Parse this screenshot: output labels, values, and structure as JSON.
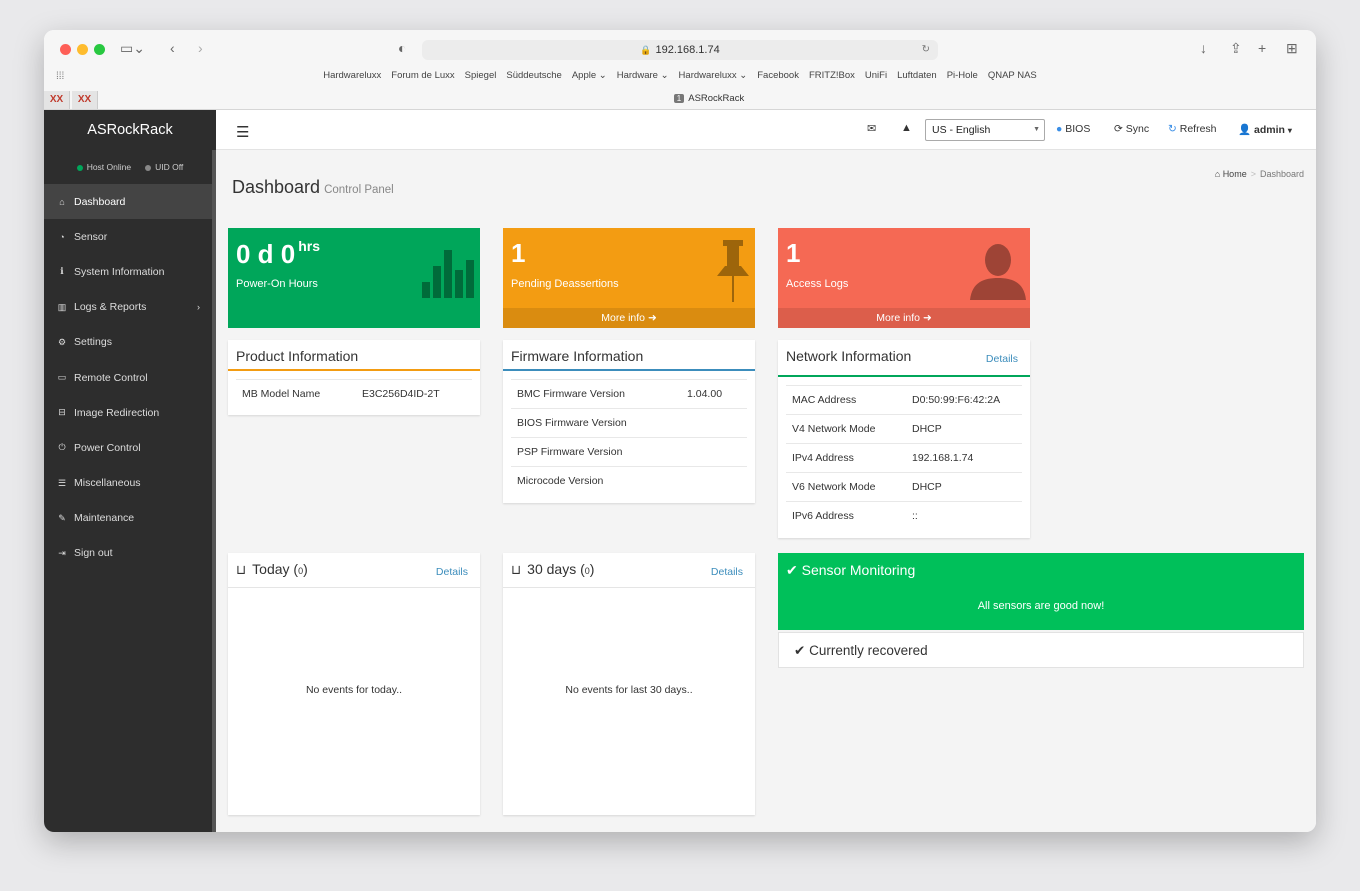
{
  "browser": {
    "url": "192.168.1.74",
    "tab_title": "ASRockRack",
    "tab_number": "1",
    "favicons": [
      "XX",
      "XX"
    ],
    "bookmarks": [
      "Hardwareluxx",
      "Forum de Luxx",
      "Spiegel",
      "Süddeutsche",
      "Apple ⌄",
      "Hardware ⌄",
      "Hardwareluxx ⌄",
      "Facebook",
      "FRITZ!Box",
      "UniFi",
      "Luftdaten",
      "Pi-Hole",
      "QNAP NAS"
    ]
  },
  "sidebar": {
    "brand": "ASRockRack",
    "host_status": "Host Online",
    "uid_status": "UID Off",
    "items": [
      {
        "label": "Dashboard",
        "icon": "home-icon"
      },
      {
        "label": "Sensor",
        "icon": "gauge-icon"
      },
      {
        "label": "System Information",
        "icon": "info-icon"
      },
      {
        "label": "Logs & Reports",
        "icon": "bar-chart-icon"
      },
      {
        "label": "Settings",
        "icon": "gear-icon"
      },
      {
        "label": "Remote Control",
        "icon": "monitor-icon"
      },
      {
        "label": "Image Redirection",
        "icon": "drive-icon"
      },
      {
        "label": "Power Control",
        "icon": "power-icon"
      },
      {
        "label": "Miscellaneous",
        "icon": "list-icon"
      },
      {
        "label": "Maintenance",
        "icon": "wrench-icon"
      },
      {
        "label": "Sign out",
        "icon": "sign-out-icon"
      }
    ]
  },
  "topbar": {
    "language": "US - English",
    "bios": "BIOS",
    "sync": "Sync",
    "refresh": "Refresh",
    "user": "admin"
  },
  "page": {
    "title": "Dashboard",
    "subtitle": "Control Panel",
    "breadcrumb_home": "Home",
    "breadcrumb_current": "Dashboard"
  },
  "tiles": {
    "power": {
      "value": "0 d 0",
      "unit": "hrs",
      "label": "Power-On Hours",
      "color": "#00a65a"
    },
    "pending": {
      "value": "1",
      "label": "Pending Deassertions",
      "more": "More info",
      "color": "#f39c12"
    },
    "access": {
      "value": "1",
      "label": "Access Logs",
      "more": "More info",
      "color": "#f56954"
    }
  },
  "product": {
    "title": "Product Information",
    "rows": [
      {
        "key": "MB Model Name",
        "value": "E3C256D4ID-2T"
      }
    ]
  },
  "firmware": {
    "title": "Firmware Information",
    "rows": [
      {
        "key": "BMC Firmware Version",
        "value": "1.04.00"
      },
      {
        "key": "BIOS Firmware Version",
        "value": ""
      },
      {
        "key": "PSP Firmware Version",
        "value": ""
      },
      {
        "key": "Microcode Version",
        "value": ""
      }
    ]
  },
  "network": {
    "title": "Network Information",
    "details": "Details",
    "rows": [
      {
        "key": "MAC Address",
        "value": "D0:50:99:F6:42:2A"
      },
      {
        "key": "V4 Network Mode",
        "value": "DHCP"
      },
      {
        "key": "IPv4 Address",
        "value": "192.168.1.74"
      },
      {
        "key": "V6 Network Mode",
        "value": "DHCP"
      },
      {
        "key": "IPv6 Address",
        "value": "::"
      }
    ]
  },
  "today": {
    "title": "Today (",
    "count": "0",
    "close": ")",
    "details": "Details",
    "empty": "No events for today.."
  },
  "thirty": {
    "title": "30 days (",
    "count": "0",
    "close": ")",
    "details": "Details",
    "empty": "No events for last 30 days.."
  },
  "sensor": {
    "title": "Sensor Monitoring",
    "message": "All sensors are good now!",
    "recovered": "Currently recovered"
  }
}
